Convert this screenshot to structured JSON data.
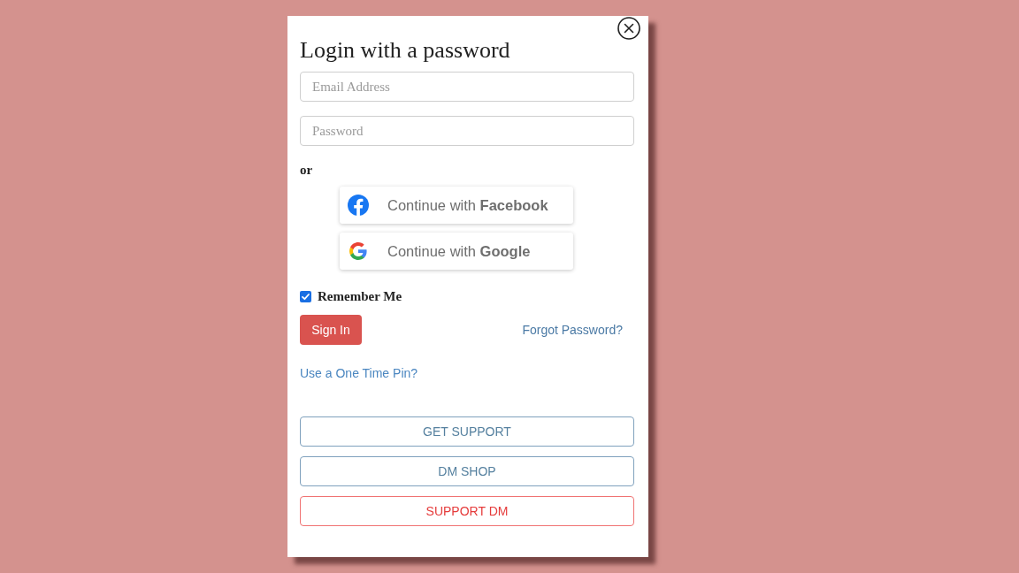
{
  "dialog": {
    "title": "Login with a password",
    "fields": [
      {
        "placeholder": "Email Address"
      },
      {
        "placeholder": "Password"
      }
    ],
    "separator": "or",
    "social_buttons": [
      {
        "kind": "facebook",
        "label": "Continue with **Facebook**"
      },
      {
        "kind": "google",
        "label": "Continue with **Google**"
      }
    ],
    "remember_me": {
      "label": "Remember Me",
      "checked": true
    },
    "sign_in": "Sign In",
    "forgot_password": "Forgot Password?",
    "one_time_pin": "Use a One Time Pin?",
    "footer_buttons": [
      {
        "kind": "default",
        "label": "GET SUPPORT"
      },
      {
        "kind": "default",
        "label": "DM SHOP"
      },
      {
        "kind": "danger",
        "label": "SUPPORT DM"
      }
    ]
  }
}
